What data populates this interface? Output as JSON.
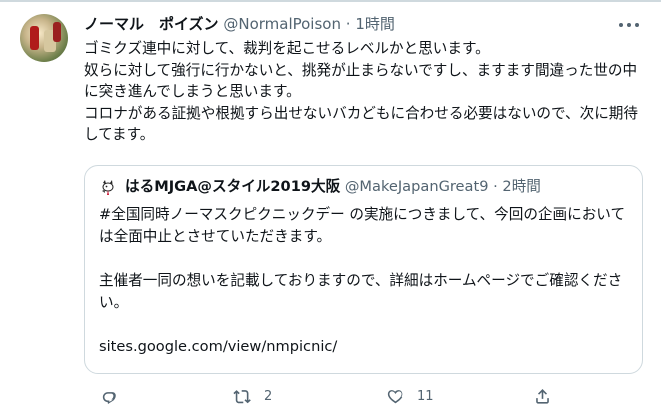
{
  "tweet": {
    "author": {
      "name": "ノーマル　ポイズン",
      "handle": "@NormalPoison",
      "dot": "·",
      "time": "1時間"
    },
    "text": "ゴミクズ連中に対して、裁判を起こせるレベルかと思います。\n奴らに対して強行に行かないと、挑発が止まらないですし、ますます間違った世の中に突き進んでしまうと思います。\nコロナがある証拠や根拠すら出せないバカどもに合わせる必要はないので、次に期待してます。",
    "quoted": {
      "name": "はるMJGA@スタイル2019大阪",
      "handle": "@MakeJapanGreat9",
      "dot": "·",
      "time": "2時間",
      "text": "#全国同時ノーマスクピクニックデー の実施につきまして、今回の企画においては全面中止とさせていただきます。\n\n主催者一同の想いを記載しておりますので、詳細はホームページでご確認ください。\n\nsites.google.com/view/nmpicnic/"
    },
    "actions": {
      "reply_icon": "reply-icon",
      "retweet_icon": "retweet-icon",
      "retweet_count": "2",
      "like_icon": "like-icon",
      "like_count": "11",
      "share_icon": "share-icon"
    }
  },
  "colors": {
    "text": "#0f1419",
    "secondary": "#536471",
    "border": "#cfd9de"
  }
}
